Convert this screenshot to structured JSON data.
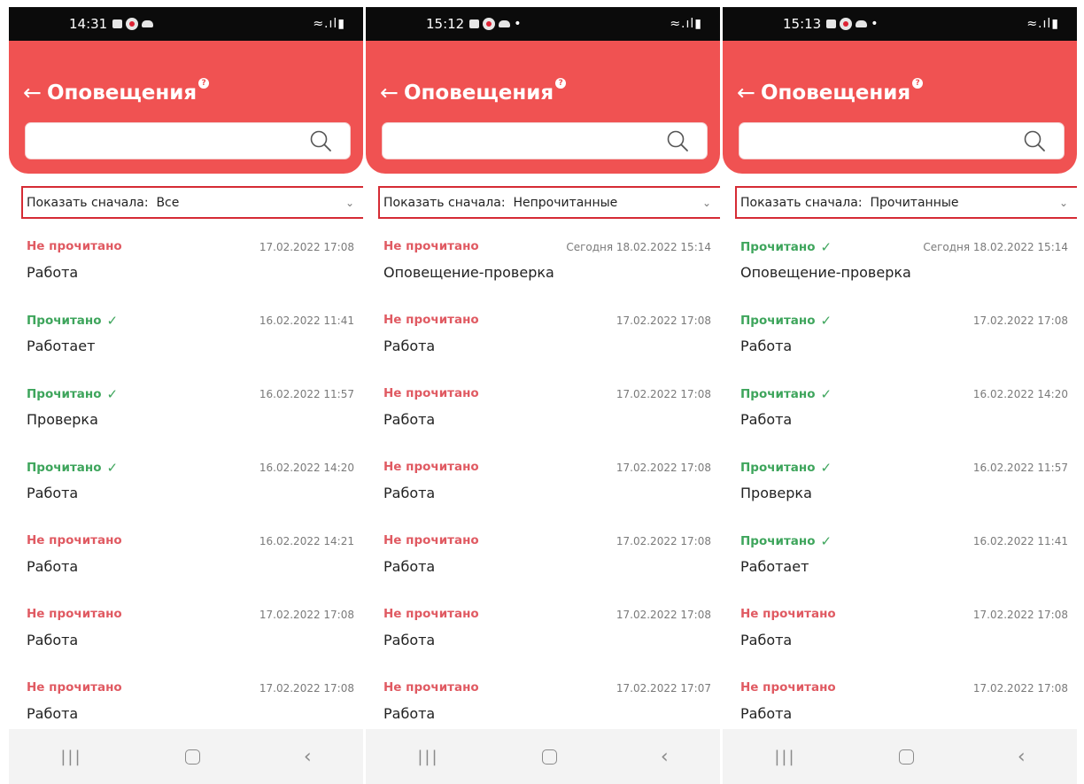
{
  "app": {
    "title": "Оповещения",
    "back_icon": "arrow-left-icon",
    "help_icon": "question-badge-icon",
    "search_icon": "magnifier-icon"
  },
  "colors": {
    "header": "#f05252",
    "unread": "#e05a62",
    "read": "#3ea55c",
    "highlight_border": "#d52b34"
  },
  "screens": [
    {
      "time": "14:31",
      "filter": {
        "label": "Показать сначала:",
        "value": "Все"
      },
      "items": [
        {
          "status": "Не прочитано",
          "read": false,
          "date": "17.02.2022 17:08",
          "name": "Работа"
        },
        {
          "status": "Прочитано",
          "read": true,
          "date": "16.02.2022 11:41",
          "name": "Работает"
        },
        {
          "status": "Прочитано",
          "read": true,
          "date": "16.02.2022 11:57",
          "name": "Проверка"
        },
        {
          "status": "Прочитано",
          "read": true,
          "date": "16.02.2022 14:20",
          "name": "Работа"
        },
        {
          "status": "Не прочитано",
          "read": false,
          "date": "16.02.2022 14:21",
          "name": "Работа"
        },
        {
          "status": "Не прочитано",
          "read": false,
          "date": "17.02.2022 17:08",
          "name": "Работа"
        },
        {
          "status": "Не прочитано",
          "read": false,
          "date": "17.02.2022 17:08",
          "name": "Работа"
        }
      ]
    },
    {
      "time": "15:12",
      "filter": {
        "label": "Показать сначала:",
        "value": "Непрочитанные"
      },
      "items": [
        {
          "status": "Не прочитано",
          "read": false,
          "date": "Сегодня 18.02.2022 15:14",
          "name": "Оповещение-проверка"
        },
        {
          "status": "Не прочитано",
          "read": false,
          "date": "17.02.2022 17:08",
          "name": "Работа"
        },
        {
          "status": "Не прочитано",
          "read": false,
          "date": "17.02.2022 17:08",
          "name": "Работа"
        },
        {
          "status": "Не прочитано",
          "read": false,
          "date": "17.02.2022 17:08",
          "name": "Работа"
        },
        {
          "status": "Не прочитано",
          "read": false,
          "date": "17.02.2022 17:08",
          "name": "Работа"
        },
        {
          "status": "Не прочитано",
          "read": false,
          "date": "17.02.2022 17:08",
          "name": "Работа"
        },
        {
          "status": "Не прочитано",
          "read": false,
          "date": "17.02.2022 17:07",
          "name": "Работа"
        }
      ]
    },
    {
      "time": "15:13",
      "filter": {
        "label": "Показать сначала:",
        "value": "Прочитанные"
      },
      "items": [
        {
          "status": "Прочитано",
          "read": true,
          "date": "Сегодня 18.02.2022 15:14",
          "name": "Оповещение-проверка"
        },
        {
          "status": "Прочитано",
          "read": true,
          "date": "17.02.2022 17:08",
          "name": "Работа"
        },
        {
          "status": "Прочитано",
          "read": true,
          "date": "16.02.2022 14:20",
          "name": "Работа"
        },
        {
          "status": "Прочитано",
          "read": true,
          "date": "16.02.2022 11:57",
          "name": "Проверка"
        },
        {
          "status": "Прочитано",
          "read": true,
          "date": "16.02.2022 11:41",
          "name": "Работает"
        },
        {
          "status": "Не прочитано",
          "read": false,
          "date": "17.02.2022 17:08",
          "name": "Работа"
        },
        {
          "status": "Не прочитано",
          "read": false,
          "date": "17.02.2022 17:08",
          "name": "Работа"
        }
      ]
    }
  ]
}
